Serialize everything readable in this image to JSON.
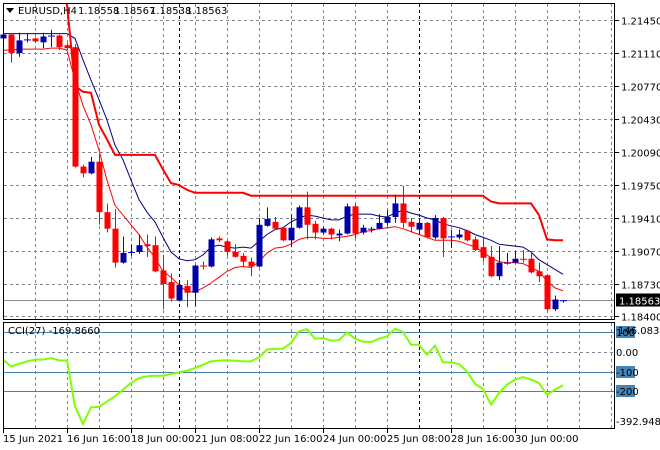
{
  "header": {
    "symbol": "EURUSD,H4",
    "open": "1.18558",
    "high": "1.18567",
    "low": "1.18538",
    "close": "1.18563",
    "menu_icon": "triangle-down-icon"
  },
  "price_axis": {
    "ticks": [
      "1.21450",
      "1.21110",
      "1.20770",
      "1.20430",
      "1.20090",
      "1.19750",
      "1.19410",
      "1.19070",
      "1.18730",
      "1.18400"
    ],
    "current_price_label": "1.18563"
  },
  "cci_panel": {
    "title": "CCI(27) -169.8660",
    "max_label": "146.083",
    "min_label": "-392.9481",
    "levels": [
      "100",
      "0.00",
      "-100",
      "-200"
    ]
  },
  "time_axis": {
    "labels": [
      "15 Jun 2021",
      "16 Jun 16:00",
      "18 Jun 00:00",
      "21 Jun 08:00",
      "22 Jun 16:00",
      "24 Jun 00:00",
      "25 Jun 08:00",
      "28 Jun 16:00",
      "30 Jun 00:00"
    ]
  },
  "colors": {
    "bull": "#0000a8",
    "bear": "#ff0000",
    "ma_slow": "#000080",
    "ma_fast": "#ff0000",
    "stop_line": "#ff0000",
    "cci": "#7fff00",
    "level_line": "#4682b4",
    "grid": "#7a8694"
  },
  "chart_data": {
    "type": "candlestick",
    "symbol": "EURUSD",
    "timeframe": "H4",
    "ylim": [
      1.184,
      1.2145
    ],
    "candles_ohlc": [
      [
        1.2126,
        1.2131,
        1.2125,
        1.213
      ],
      [
        1.213,
        1.2131,
        1.2101,
        1.2111
      ],
      [
        1.2111,
        1.2132,
        1.2107,
        1.2124
      ],
      [
        1.2124,
        1.2131,
        1.2122,
        1.2125
      ],
      [
        1.2126,
        1.2127,
        1.2122,
        1.2123
      ],
      [
        1.2122,
        1.2132,
        1.2116,
        1.2128
      ],
      [
        1.2128,
        1.2135,
        1.2117,
        1.2129
      ],
      [
        1.2129,
        1.213,
        1.2114,
        1.2117
      ],
      [
        1.2119,
        1.2121,
        1.2114,
        1.2116
      ],
      [
        1.2117,
        1.212,
        1.1993,
        1.1994
      ],
      [
        1.1994,
        1.1996,
        1.1983,
        1.1987
      ],
      [
        1.1987,
        1.2004,
        1.1986,
        1.1999
      ],
      [
        1.1999,
        1.2007,
        1.1934,
        1.1947
      ],
      [
        1.1947,
        1.1956,
        1.1926,
        1.193
      ],
      [
        1.193,
        1.195,
        1.189,
        1.1895
      ],
      [
        1.1895,
        1.1922,
        1.1894,
        1.1905
      ],
      [
        1.1905,
        1.1914,
        1.1902,
        1.1906
      ],
      [
        1.1906,
        1.1924,
        1.1904,
        1.1913
      ],
      [
        1.1914,
        1.1924,
        1.1901,
        1.1912
      ],
      [
        1.1913,
        1.1922,
        1.1885,
        1.1886
      ],
      [
        1.1887,
        1.1903,
        1.1847,
        1.1873
      ],
      [
        1.1875,
        1.1884,
        1.1855,
        1.1858
      ],
      [
        1.1856,
        1.1876,
        1.1855,
        1.1872
      ],
      [
        1.1871,
        1.1877,
        1.1849,
        1.1864
      ],
      [
        1.1864,
        1.1893,
        1.185,
        1.1892
      ],
      [
        1.1892,
        1.1896,
        1.1888,
        1.1891
      ],
      [
        1.1891,
        1.1921,
        1.189,
        1.1919
      ],
      [
        1.192,
        1.1922,
        1.1916,
        1.1918
      ],
      [
        1.1917,
        1.1918,
        1.1902,
        1.1906
      ],
      [
        1.1906,
        1.1914,
        1.19,
        1.1901
      ],
      [
        1.1902,
        1.1905,
        1.1891,
        1.1896
      ],
      [
        1.1896,
        1.19,
        1.1881,
        1.1891
      ],
      [
        1.1891,
        1.1941,
        1.189,
        1.1934
      ],
      [
        1.1933,
        1.1952,
        1.1932,
        1.194
      ],
      [
        1.1937,
        1.1942,
        1.1929,
        1.193
      ],
      [
        1.1931,
        1.1932,
        1.1917,
        1.1918
      ],
      [
        1.1918,
        1.1945,
        1.1911,
        1.1931
      ],
      [
        1.1931,
        1.1954,
        1.193,
        1.1952
      ],
      [
        1.1952,
        1.1968,
        1.1919,
        1.1934
      ],
      [
        1.1935,
        1.1938,
        1.1919,
        1.1926
      ],
      [
        1.1926,
        1.1932,
        1.1924,
        1.193
      ],
      [
        1.193,
        1.1931,
        1.1919,
        1.1924
      ],
      [
        1.1923,
        1.1929,
        1.1917,
        1.1925
      ],
      [
        1.1925,
        1.1956,
        1.1924,
        1.1953
      ],
      [
        1.1953,
        1.1956,
        1.192,
        1.1925
      ],
      [
        1.1926,
        1.1934,
        1.1924,
        1.1931
      ],
      [
        1.1929,
        1.1932,
        1.1926,
        1.193
      ],
      [
        1.193,
        1.1945,
        1.1929,
        1.1936
      ],
      [
        1.1936,
        1.1949,
        1.1933,
        1.1942
      ],
      [
        1.1942,
        1.1965,
        1.1936,
        1.1956
      ],
      [
        1.1956,
        1.1974,
        1.1931,
        1.1936
      ],
      [
        1.1937,
        1.1941,
        1.1926,
        1.1932
      ],
      [
        1.1929,
        1.1941,
        1.1926,
        1.1936
      ],
      [
        1.1936,
        1.1937,
        1.192,
        1.1921
      ],
      [
        1.1921,
        1.1944,
        1.1919,
        1.1941
      ],
      [
        1.1941,
        1.1942,
        1.1901,
        1.192
      ],
      [
        1.1921,
        1.1929,
        1.191,
        1.1922
      ],
      [
        1.1921,
        1.1929,
        1.1919,
        1.1924
      ],
      [
        1.1928,
        1.1929,
        1.1917,
        1.1918
      ],
      [
        1.1919,
        1.1922,
        1.1907,
        1.1908
      ],
      [
        1.1911,
        1.1922,
        1.1896,
        1.19
      ],
      [
        1.1901,
        1.1912,
        1.188,
        1.1881
      ],
      [
        1.1881,
        1.1912,
        1.1877,
        1.1895
      ],
      [
        1.1894,
        1.1905,
        1.1893,
        1.1895
      ],
      [
        1.1895,
        1.1907,
        1.1894,
        1.1899
      ],
      [
        1.1899,
        1.1908,
        1.1895,
        1.1898
      ],
      [
        1.1899,
        1.1907,
        1.1884,
        1.1885
      ],
      [
        1.1886,
        1.1895,
        1.1875,
        1.1881
      ],
      [
        1.1882,
        1.1883,
        1.1845,
        1.1847
      ],
      [
        1.1847,
        1.1861,
        1.1845,
        1.1857
      ],
      [
        1.18558,
        1.18567,
        1.18538,
        1.18563
      ]
    ],
    "ma_slow": [
      1.2131,
      1.2131,
      1.2131,
      1.2131,
      1.2131,
      1.2131,
      1.2131,
      1.2131,
      1.2131,
      1.2126,
      1.2104,
      1.2083,
      1.2063,
      1.2042,
      1.2016,
      1.2001,
      1.198,
      1.196,
      1.1947,
      1.1937,
      1.1921,
      1.1906,
      1.1899,
      1.1897,
      1.1898,
      1.1903,
      1.1911,
      1.1913,
      1.1911,
      1.191,
      1.1911,
      1.191,
      1.1917,
      1.1924,
      1.1929,
      1.1931,
      1.1937,
      1.1941,
      1.1944,
      1.1943,
      1.1941,
      1.1939,
      1.1939,
      1.1943,
      1.1945,
      1.1945,
      1.1945,
      1.1943,
      1.1942,
      1.1946,
      1.1949,
      1.1946,
      1.1944,
      1.1941,
      1.1939,
      1.1935,
      1.1933,
      1.1931,
      1.1928,
      1.1924,
      1.1921,
      1.1918,
      1.1914,
      1.1913,
      1.1912,
      1.1911,
      1.1906,
      1.1898,
      1.1893,
      1.1888,
      1.1883
    ],
    "ma_fast": [
      1.2114,
      1.2114,
      1.2115,
      1.2115,
      1.2115,
      1.2115,
      1.2116,
      1.2116,
      1.2114,
      1.2083,
      1.2057,
      1.2037,
      1.2011,
      1.198,
      1.1954,
      1.1944,
      1.1934,
      1.1924,
      1.1911,
      1.19,
      1.1886,
      1.188,
      1.1872,
      1.1865,
      1.1865,
      1.1869,
      1.1874,
      1.188,
      1.1886,
      1.189,
      1.1891,
      1.189,
      1.1896,
      1.1905,
      1.191,
      1.1911,
      1.1914,
      1.1919,
      1.1921,
      1.1921,
      1.192,
      1.192,
      1.1921,
      1.1922,
      1.1924,
      1.1927,
      1.1928,
      1.193,
      1.1931,
      1.1932,
      1.193,
      1.1927,
      1.1924,
      1.1921,
      1.1918,
      1.1918,
      1.1918,
      1.1917,
      1.1914,
      1.1911,
      1.1906,
      1.19,
      1.1896,
      1.1895,
      1.1895,
      1.1894,
      1.189,
      1.1886,
      1.1876,
      1.1869,
      1.1866
    ],
    "stop_line": [
      null,
      null,
      null,
      null,
      null,
      null,
      null,
      null,
      1.2161,
      1.2077,
      1.2071,
      1.207,
      1.2037,
      1.2022,
      1.2006,
      1.2006,
      1.2006,
      1.2006,
      1.2006,
      1.2006,
      1.1991,
      1.1977,
      1.1975,
      1.197,
      1.1967,
      1.1967,
      1.1967,
      1.1967,
      1.1967,
      1.1967,
      1.1967,
      1.1964,
      1.1964,
      1.1964,
      1.1964,
      1.1964,
      1.1964,
      1.1964,
      1.1964,
      1.1964,
      1.1964,
      1.1964,
      1.1964,
      1.1964,
      1.1964,
      1.1964,
      1.1964,
      1.1964,
      1.1964,
      1.1964,
      1.1964,
      1.1964,
      1.1964,
      1.1964,
      1.1964,
      1.1964,
      1.1964,
      1.1964,
      1.1964,
      1.1964,
      1.1964,
      1.1958,
      1.1956,
      1.1956,
      1.1956,
      1.1956,
      1.1956,
      1.1944,
      1.1919,
      1.1918,
      1.1918
    ],
    "cci": {
      "period": 27,
      "ylim": [
        -392.9481,
        146.083
      ],
      "levels": [
        100,
        0,
        -100,
        -200
      ],
      "values": [
        -39,
        -73,
        -61,
        -48,
        -39,
        -39,
        -31,
        -42,
        -44,
        -277,
        -367,
        -282,
        -280,
        -252,
        -226,
        -192,
        -158,
        -133,
        -124,
        -121,
        -121,
        -112,
        -104,
        -95,
        -82,
        -65,
        -48,
        -44,
        -42,
        -44,
        -48,
        -48,
        -27,
        12,
        17,
        17,
        46,
        105,
        117,
        68,
        71,
        58,
        60,
        100,
        68,
        53,
        51,
        68,
        80,
        119,
        102,
        37,
        37,
        -14,
        32,
        -53,
        -53,
        -61,
        -99,
        -163,
        -189,
        -269,
        -209,
        -167,
        -141,
        -128,
        -141,
        -158,
        -218,
        -192,
        -169.866
      ]
    },
    "xlabels": [
      "15 Jun 2021",
      "16 Jun 16:00",
      "18 Jun 00:00",
      "21 Jun 08:00",
      "22 Jun 16:00",
      "24 Jun 00:00",
      "25 Jun 08:00",
      "28 Jun 16:00",
      "30 Jun 00:00"
    ],
    "grid": true
  }
}
